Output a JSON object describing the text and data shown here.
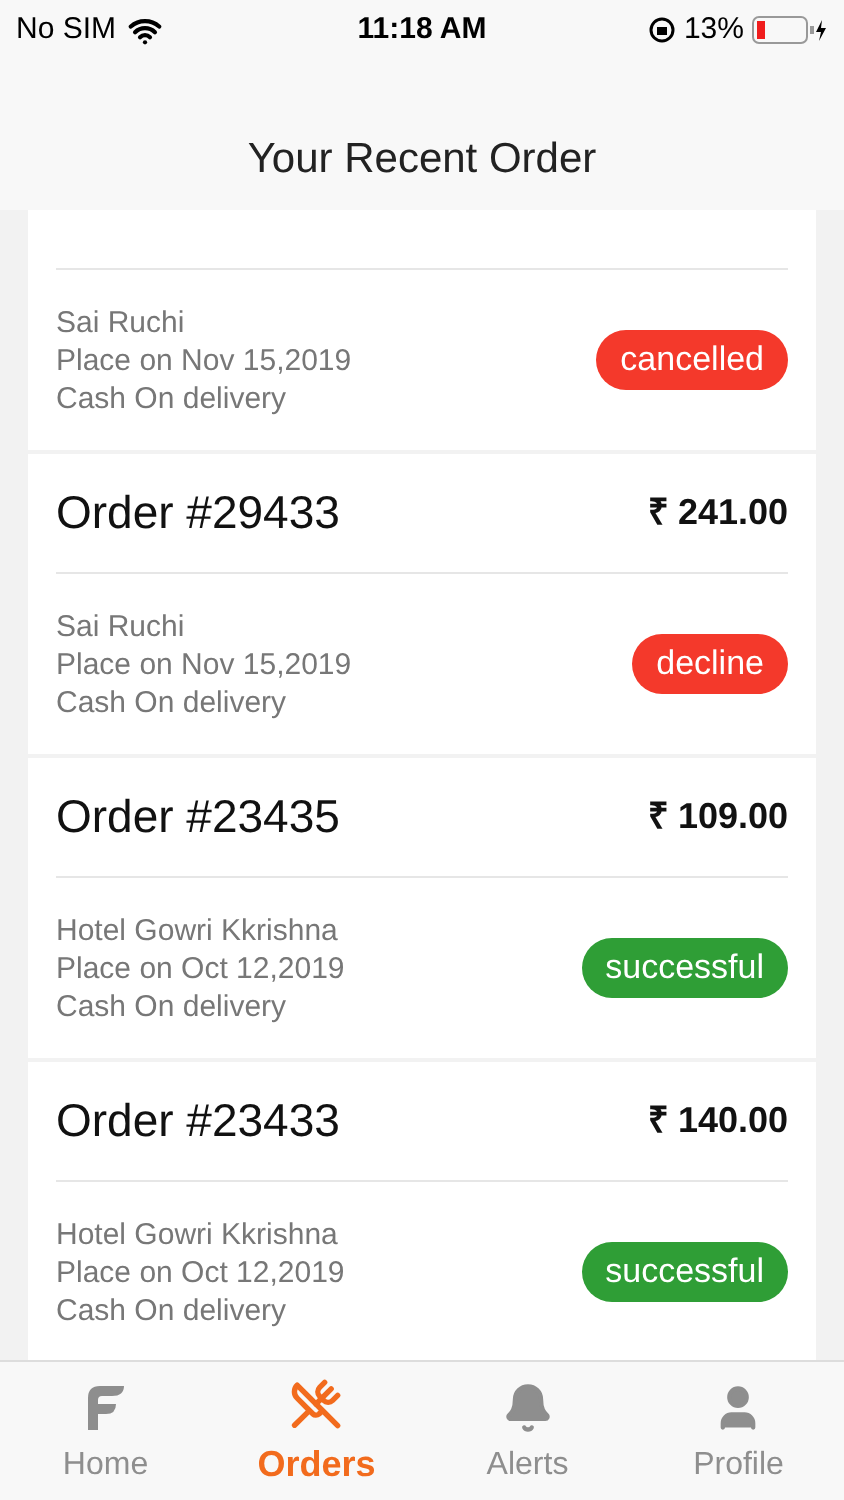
{
  "status_bar": {
    "carrier": "No SIM",
    "time": "11:18 AM",
    "battery": "13%"
  },
  "header": {
    "title": "Your Recent Order"
  },
  "orders": [
    {
      "restaurant": "Sai Ruchi",
      "placed": "Place on Nov 15,2019",
      "payment": "Cash On delivery",
      "status": {
        "label": "cancelled",
        "color": "#f4392b"
      }
    },
    {
      "title": "Order #29433",
      "amount": "₹ 241.00",
      "restaurant": "Sai Ruchi",
      "placed": "Place on Nov 15,2019",
      "payment": "Cash On delivery",
      "status": {
        "label": "decline",
        "color": "#f4392b"
      }
    },
    {
      "title": "Order #23435",
      "amount": "₹ 109.00",
      "restaurant": "Hotel Gowri Kkrishna",
      "placed": "Place on Oct 12,2019",
      "payment": "Cash On delivery",
      "status": {
        "label": "successful",
        "color": "#2f9e36"
      }
    },
    {
      "title": "Order #23433",
      "amount": "₹ 140.00",
      "restaurant": "Hotel Gowri Kkrishna",
      "placed": "Place on Oct 12,2019",
      "payment": "Cash On delivery",
      "status": {
        "label": "successful",
        "color": "#2f9e36"
      }
    }
  ],
  "tabs": [
    {
      "kind": "home",
      "label": "Home",
      "selected": false
    },
    {
      "kind": "orders",
      "label": "Orders",
      "selected": true
    },
    {
      "kind": "alerts",
      "label": "Alerts",
      "selected": false
    },
    {
      "kind": "profile",
      "label": "Profile",
      "selected": false
    }
  ]
}
